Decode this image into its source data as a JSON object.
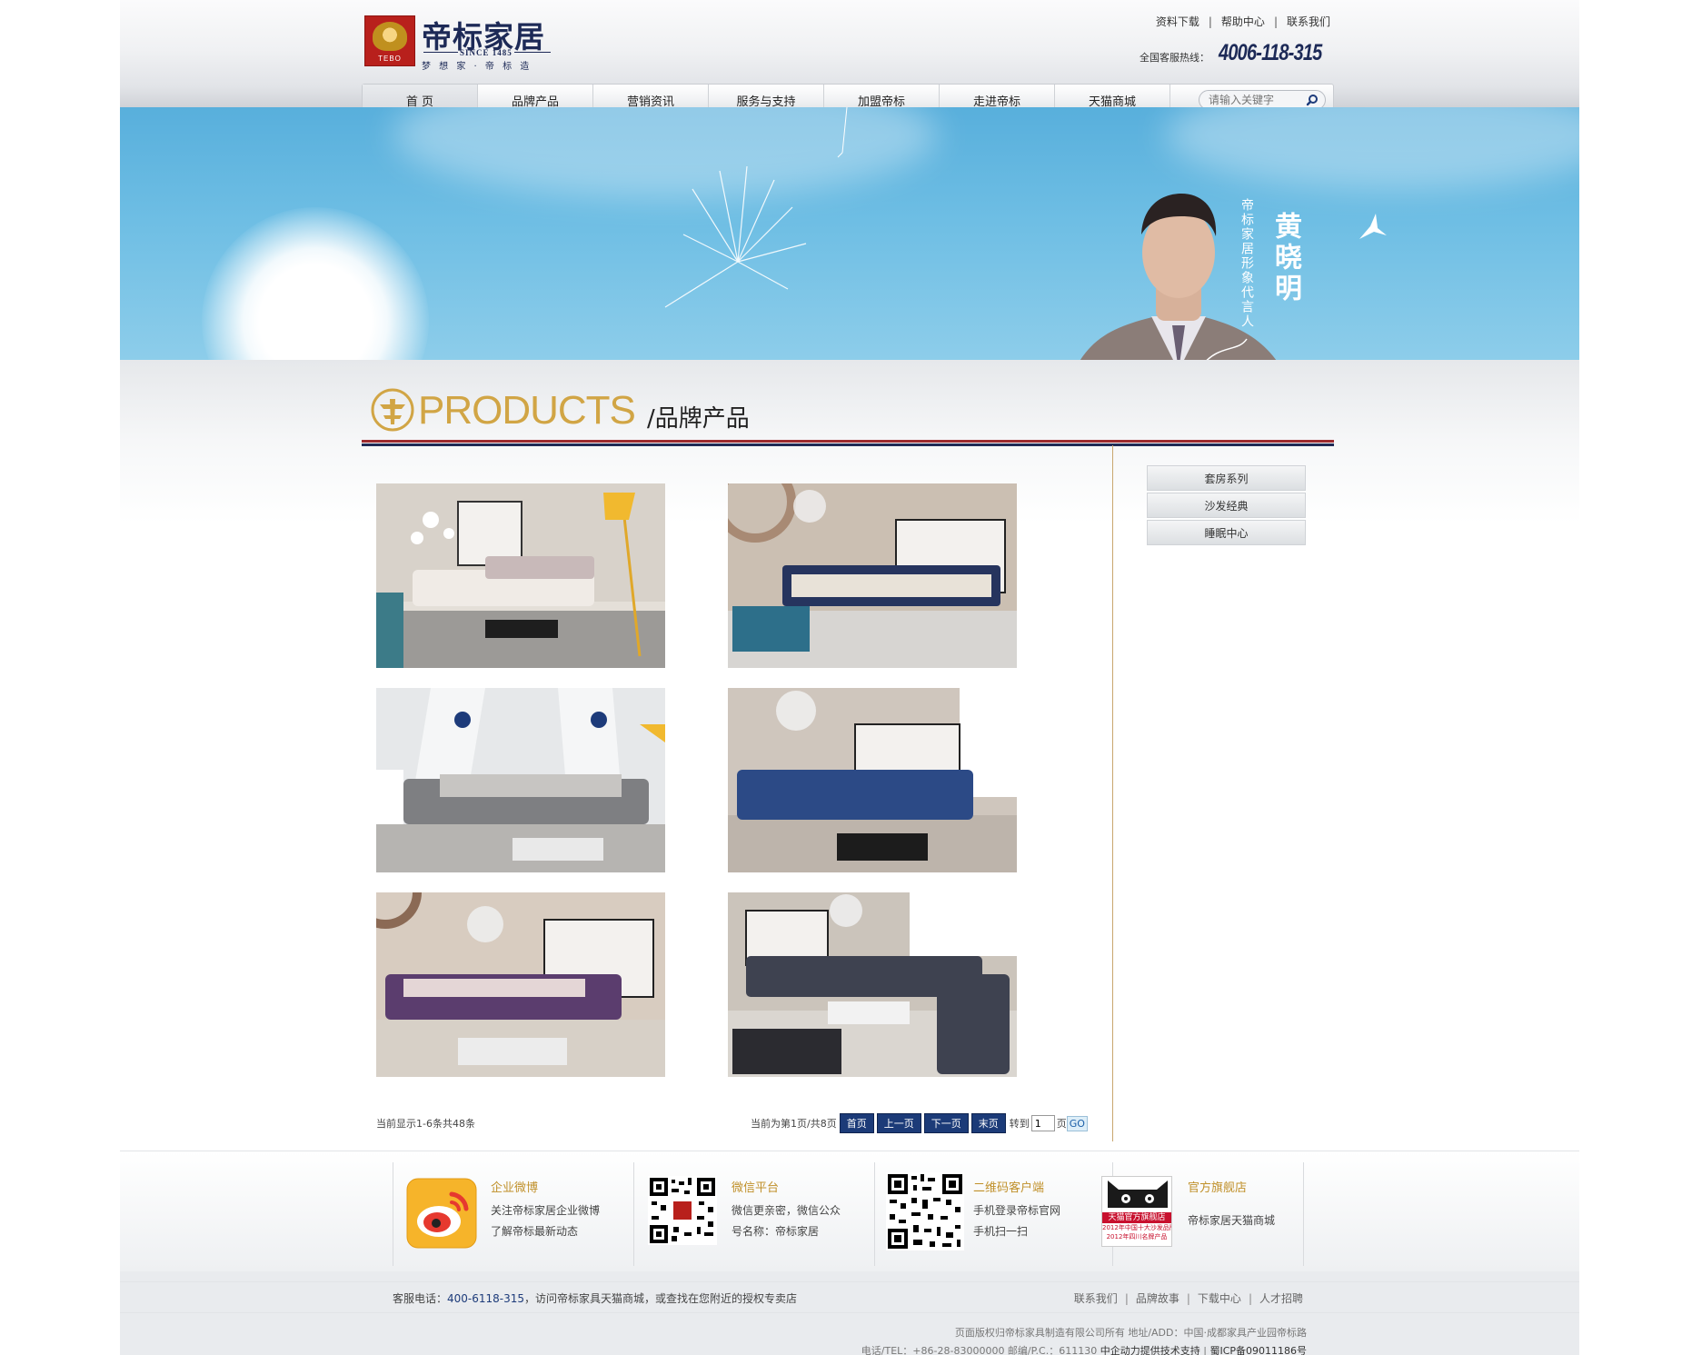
{
  "brand": {
    "name_cn": "帝标家居",
    "since": "SINCE 1485",
    "slogan": "梦 想 家 · 帝 标 造",
    "logo_text": "TEBO"
  },
  "toplinks": [
    "资料下载",
    "帮助中心",
    "联系我们"
  ],
  "hotline": {
    "label": "全国客服热线：",
    "number": "4006-118-315"
  },
  "nav": {
    "items": [
      "首 页",
      "品牌产品",
      "营销资讯",
      "服务与支持",
      "加盟帝标",
      "走进帝标",
      "天猫商城"
    ],
    "active_index": 0,
    "search_placeholder": "请输入关键字"
  },
  "banner": {
    "spokesperson_name": "黄晓明",
    "spokesperson_title": "帝标家居形象代言人"
  },
  "section": {
    "title_en": "PRODUCTS",
    "title_cn": "/品牌产品"
  },
  "products": [
    {
      "theme": "white-pink sofa, yellow lamp",
      "colors": [
        "#e9e4de",
        "#d7cfc6",
        "#f1b92f"
      ]
    },
    {
      "theme": "navy-beige sectional",
      "colors": [
        "#cbbfb2",
        "#26345e",
        "#e8e2d8"
      ]
    },
    {
      "theme": "grey sectional, white wall",
      "colors": [
        "#e6e8ea",
        "#7e7f82",
        "#c7c5c2"
      ]
    },
    {
      "theme": "blue modular sofa",
      "colors": [
        "#cfc6bd",
        "#2c4a86",
        "#bdb4ab"
      ]
    },
    {
      "theme": "purple sectional",
      "colors": [
        "#d8ccc0",
        "#5b3d6e",
        "#d7d0c7"
      ]
    },
    {
      "theme": "dark grey sectional",
      "colors": [
        "#cbc4bb",
        "#3e4250",
        "#dad6d0"
      ]
    }
  ],
  "side_menu": [
    "套房系列",
    "沙发经典",
    "睡眠中心"
  ],
  "pager": {
    "summary": "当前显示1-6条共48条",
    "status": "当前为第1页/共8页",
    "first": "首页",
    "prev": "上一页",
    "next": "下一页",
    "last": "末页",
    "goto_label": "转到",
    "goto_value": "1",
    "page_suffix": "页",
    "go": "GO"
  },
  "footer_cols": [
    {
      "title": "企业微博",
      "lines": [
        "关注帝标家居企业微博",
        "了解帝标最新动态"
      ]
    },
    {
      "title": "微信平台",
      "lines": [
        "微信更亲密，微信公众",
        "号名称：帝标家居"
      ]
    },
    {
      "title": "二维码客户端",
      "lines": [
        "手机登录帝标官网",
        "手机扫一扫"
      ]
    },
    {
      "title": "官方旗舰店",
      "lines": [
        "帝标家居天猫商城"
      ]
    }
  ],
  "tmall_badge": {
    "line1": "天猫官方旗舰店",
    "line2": "2012年中国十大沙发品牌",
    "line3": "2012年四川名牌产品"
  },
  "service": {
    "prefix": "客服电话：",
    "phone": "400-6118-315",
    "suffix": "，访问帝标家具天猫商城，或查找在您附近的授权专卖店"
  },
  "bottom_links": [
    "联系我们",
    "品牌故事",
    "下载中心",
    "人才招聘"
  ],
  "copyright": {
    "line1": "页面版权归帝标家具制造有限公司所有 地址/ADD：中国·成都家具产业园帝标路",
    "line2_a": "电话/TEL：+86-28-83000000 邮编/P.C.：611130",
    "line2_b": "中企动力提供技术支持",
    "line2_c": "蜀ICP备09011186号"
  }
}
